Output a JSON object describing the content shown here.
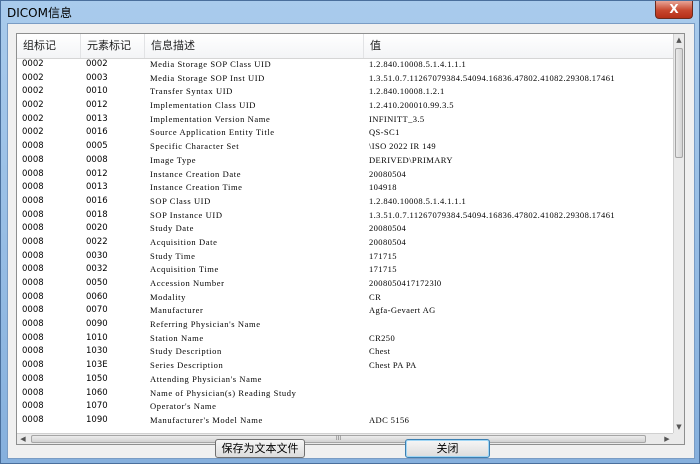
{
  "window": {
    "title": "DICOM信息",
    "close_glyph": "X"
  },
  "table": {
    "columns": [
      "组标记",
      "元素标记",
      "信息描述",
      "值"
    ],
    "rows": [
      [
        "0002",
        "0002",
        "Media Storage SOP Class UID",
        "1.2.840.10008.5.1.4.1.1.1"
      ],
      [
        "0002",
        "0003",
        "Media Storage SOP Inst UID",
        "1.3.51.0.7.11267079384.54094.16836.47802.41082.29308.17461"
      ],
      [
        "0002",
        "0010",
        "Transfer Syntax UID",
        "1.2.840.10008.1.2.1"
      ],
      [
        "0002",
        "0012",
        "Implementation Class UID",
        "1.2.410.200010.99.3.5"
      ],
      [
        "0002",
        "0013",
        "Implementation Version Name",
        "INFINITT_3.5"
      ],
      [
        "0002",
        "0016",
        "Source Application Entity Title",
        "QS-SC1"
      ],
      [
        "0008",
        "0005",
        "Specific Character Set",
        "\\ISO 2022 IR 149"
      ],
      [
        "0008",
        "0008",
        "Image Type",
        "DERIVED\\PRIMARY"
      ],
      [
        "0008",
        "0012",
        "Instance Creation Date",
        "20080504"
      ],
      [
        "0008",
        "0013",
        "Instance Creation Time",
        "104918"
      ],
      [
        "0008",
        "0016",
        "SOP Class UID",
        "1.2.840.10008.5.1.4.1.1.1"
      ],
      [
        "0008",
        "0018",
        "SOP Instance UID",
        "1.3.51.0.7.11267079384.54094.16836.47802.41082.29308.17461"
      ],
      [
        "0008",
        "0020",
        "Study Date",
        "20080504"
      ],
      [
        "0008",
        "0022",
        "Acquisition Date",
        "20080504"
      ],
      [
        "0008",
        "0030",
        "Study Time",
        "171715"
      ],
      [
        "0008",
        "0032",
        "Acquisition Time",
        "171715"
      ],
      [
        "0008",
        "0050",
        "Accession Number",
        "20080504171723l0"
      ],
      [
        "0008",
        "0060",
        "Modality",
        "CR"
      ],
      [
        "0008",
        "0070",
        "Manufacturer",
        "Agfa-Gevaert AG"
      ],
      [
        "0008",
        "0090",
        "Referring Physician's Name",
        ""
      ],
      [
        "0008",
        "1010",
        "Station Name",
        "CR250"
      ],
      [
        "0008",
        "1030",
        "Study Description",
        "Chest"
      ],
      [
        "0008",
        "103E",
        "Series Description",
        "Chest PA PA"
      ],
      [
        "0008",
        "1050",
        "Attending Physician's Name",
        ""
      ],
      [
        "0008",
        "1060",
        "Name of Physician(s) Reading Study",
        ""
      ],
      [
        "0008",
        "1070",
        "Operator's Name",
        ""
      ],
      [
        "0008",
        "1090",
        "Manufacturer's Model Name",
        "ADC 5156"
      ]
    ]
  },
  "scrollbar": {
    "h_grip": "III",
    "up_arrow": "▲",
    "down_arrow": "▼",
    "left_arrow": "◀",
    "right_arrow": "▶"
  },
  "buttons": {
    "save_label": "保存为文本文件",
    "close_label": "关闭"
  }
}
